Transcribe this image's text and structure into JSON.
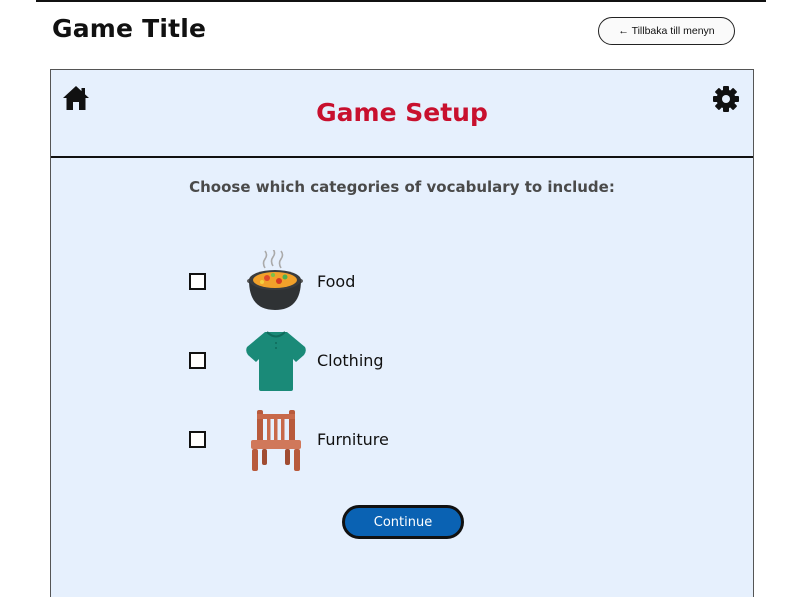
{
  "page": {
    "title": "Game Title",
    "back_button_label": "← Tillbaka till menyn"
  },
  "panel": {
    "title": "Game Setup",
    "instruction": "Choose which categories of vocabulary to include:",
    "categories": [
      {
        "label": "Food",
        "icon": "food-pot-icon",
        "checked": false
      },
      {
        "label": "Clothing",
        "icon": "shirt-icon",
        "checked": false
      },
      {
        "label": "Furniture",
        "icon": "chair-icon",
        "checked": false
      }
    ],
    "continue_label": "Continue"
  },
  "colors": {
    "title_red": "#c8102e",
    "panel_bg": "#e6f0fd",
    "button_blue": "#0a62b3",
    "shirt_green": "#1a8a78",
    "chair_brown": "#c8694a"
  }
}
